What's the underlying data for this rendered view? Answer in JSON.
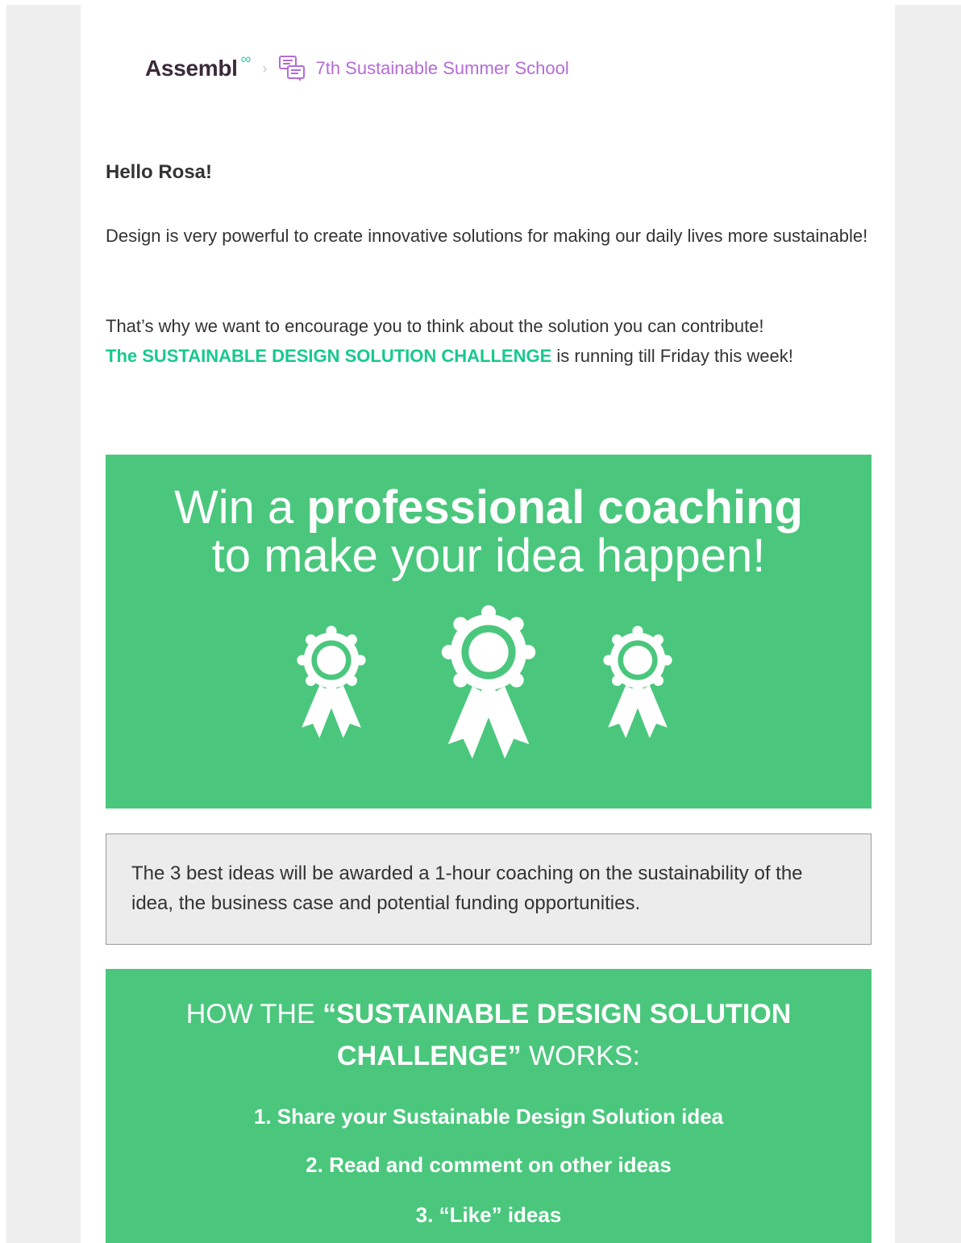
{
  "header": {
    "logo_text": "Assembl",
    "logo_mark": "∞",
    "separator": "›",
    "discussion_icon": "discussion-bubbles-icon",
    "discussion_title": "7th Sustainable Summer School"
  },
  "body": {
    "greeting": "Hello Rosa!",
    "paragraph1": "Design is very powerful to create innovative solutions for making our daily lives more sustainable!",
    "paragraph2_intro": "That’s why we want to encourage you to think about the solution you can contribute!",
    "challenge_name": "The SUSTAINABLE DESIGN SOLUTION CHALLENGE",
    "paragraph2_rest": " is running till Friday this week!"
  },
  "banner": {
    "line1_prefix": "Win a ",
    "line1_bold": "professional coaching",
    "line2": "to make your idea happen!",
    "icon": "award-ribbon-icon",
    "background_color": "#4ac77d"
  },
  "info": {
    "text": "The 3 best ideas will be awarded a 1-hour coaching on the sustainability of the idea, the business case and potential funding opportunities."
  },
  "how_it_works": {
    "title_prefix": "HOW THE ",
    "title_bold": "“SUSTAINABLE DESIGN SOLUTION CHALLENGE”",
    "title_suffix": " WORKS:",
    "steps": [
      "1. Share your Sustainable Design Solution idea",
      "2. Read and comment on other ideas",
      "3. “Like” ideas"
    ]
  },
  "colors": {
    "brand_purple": "#b46cd8",
    "highlight_green": "#17c98d",
    "panel_green": "#4ac77d"
  }
}
